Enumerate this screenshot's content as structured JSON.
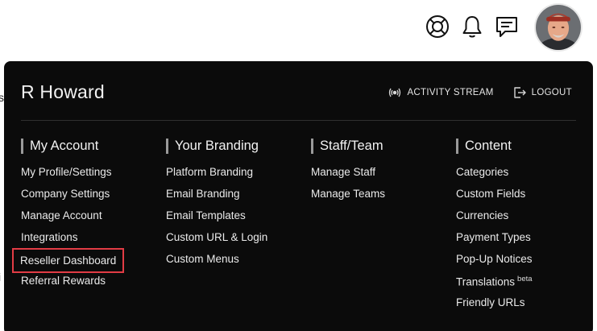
{
  "page_edge": {
    "char_1": "s",
    "char_2": "i"
  },
  "header": {
    "icons": [
      "lifebuoy-icon",
      "bell-icon",
      "message-icon"
    ],
    "avatar": "user-avatar"
  },
  "panel": {
    "user_name": "R Howard",
    "actions": [
      {
        "label": "ACTIVITY STREAM",
        "icon": "broadcast-icon"
      },
      {
        "label": "LOGOUT",
        "icon": "logout-icon"
      }
    ],
    "columns": [
      {
        "title": "My Account",
        "items": [
          "My Profile/Settings",
          "Company Settings",
          "Manage Account",
          "Integrations",
          "Reseller Dashboard",
          "Referral Rewards"
        ]
      },
      {
        "title": "Your Branding",
        "items": [
          "Platform Branding",
          "Email Branding",
          "Email Templates",
          "Custom URL & Login",
          "Custom Menus"
        ]
      },
      {
        "title": "Staff/Team",
        "items": [
          "Manage Staff",
          "Manage Teams"
        ]
      },
      {
        "title": "Content",
        "items": [
          "Categories",
          "Custom Fields",
          "Currencies",
          "Payment Types",
          "Pop-Up Notices",
          "Translations",
          "Friendly URLs"
        ],
        "badges": {
          "translations": "beta"
        }
      }
    ],
    "highlight_color": "#e23c45"
  }
}
